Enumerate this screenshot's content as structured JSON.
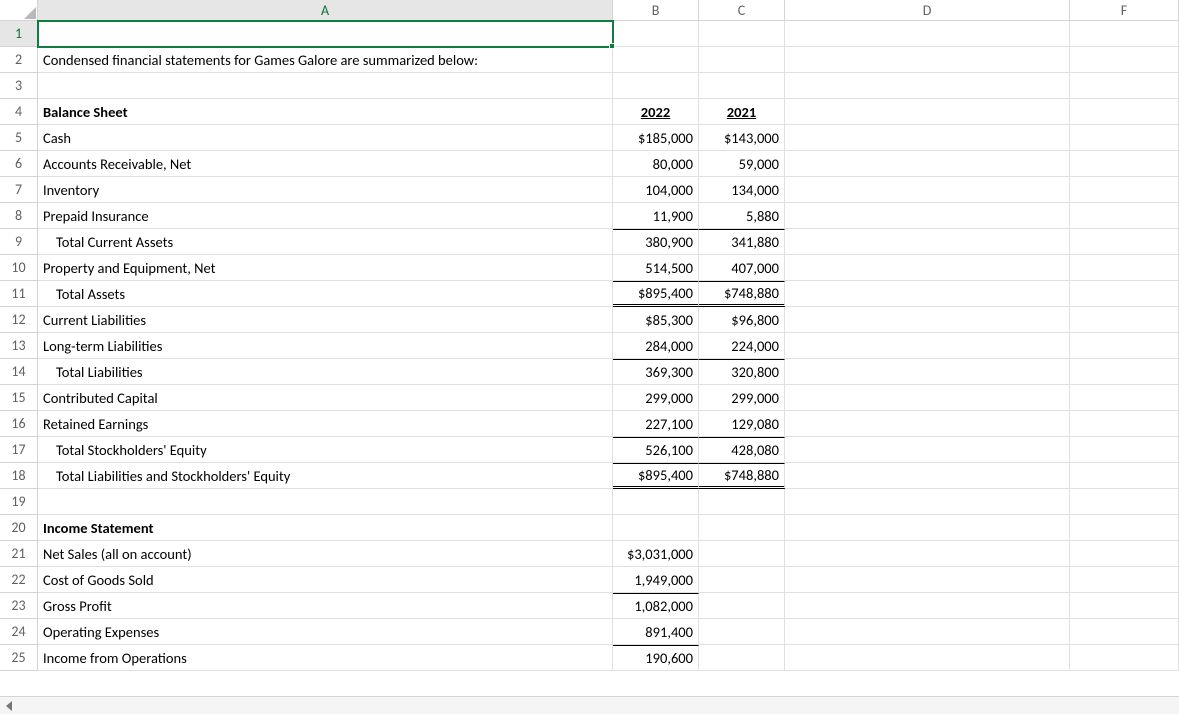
{
  "columns": [
    "A",
    "B",
    "C",
    "D",
    "F"
  ],
  "rownums": [
    "1",
    "2",
    "3",
    "4",
    "5",
    "6",
    "7",
    "8",
    "9",
    "10",
    "11",
    "12",
    "13",
    "14",
    "15",
    "16",
    "17",
    "18",
    "19",
    "20",
    "21",
    "22",
    "23",
    "24",
    "25"
  ],
  "r2a": "Condensed financial statements for Games Galore are summarized below:",
  "r4a": "Balance Sheet",
  "r4b": "2022",
  "r4c": "2021",
  "r5a": "Cash",
  "r5b": "$185,000",
  "r5c": "$143,000",
  "r6a": "Accounts Receivable, Net",
  "r6b": "80,000",
  "r6c": "59,000",
  "r7a": "Inventory",
  "r7b": "104,000",
  "r7c": "134,000",
  "r8a": "Prepaid Insurance",
  "r8b": "11,900",
  "r8c": "5,880",
  "r9a": "Total Current Assets",
  "r9b": "380,900",
  "r9c": "341,880",
  "r10a": "Property and Equipment, Net",
  "r10b": "514,500",
  "r10c": "407,000",
  "r11a": "Total Assets",
  "r11b": "$895,400",
  "r11c": "$748,880",
  "r12a": "Current Liabilities",
  "r12b": "$85,300",
  "r12c": "$96,800",
  "r13a": "Long-term Liabilities",
  "r13b": "284,000",
  "r13c": "224,000",
  "r14a": "Total Liabilities",
  "r14b": "369,300",
  "r14c": "320,800",
  "r15a": "Contributed Capital",
  "r15b": "299,000",
  "r15c": "299,000",
  "r16a": "Retained Earnings",
  "r16b": "227,100",
  "r16c": "129,080",
  "r17a": "Total Stockholders' Equity",
  "r17b": "526,100",
  "r17c": "428,080",
  "r18a": "Total Liabilities and Stockholders' Equity",
  "r18b": "$895,400",
  "r18c": "$748,880",
  "r20a": "Income Statement",
  "r21a": "Net Sales (all on account)",
  "r21b": "$3,031,000",
  "r22a": "Cost of Goods Sold",
  "r22b": "1,949,000",
  "r23a": "Gross Profit",
  "r23b": "1,082,000",
  "r24a": "Operating Expenses",
  "r24b": "891,400",
  "r25a": "Income from Operations",
  "r25b": "190,600"
}
